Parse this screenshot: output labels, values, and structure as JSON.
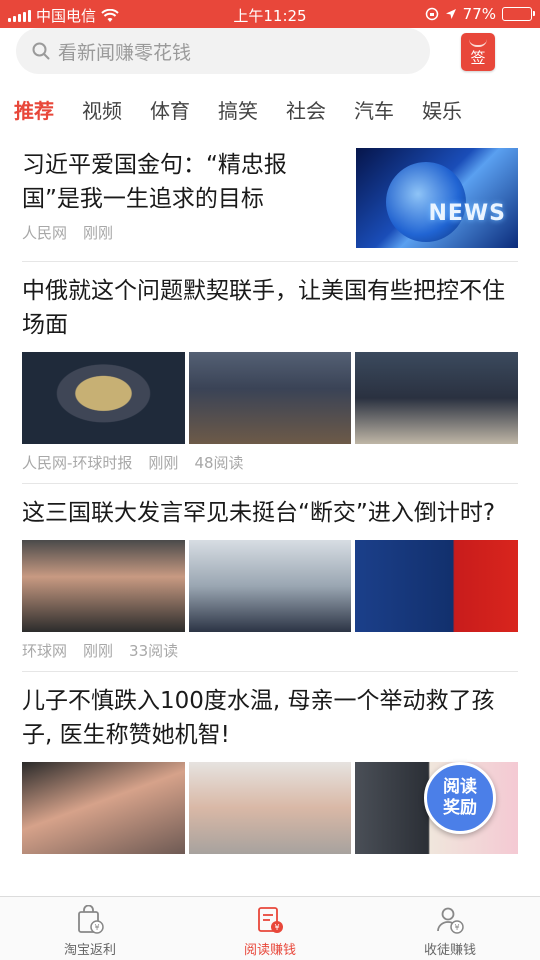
{
  "status_bar": {
    "carrier": "中国电信",
    "time": "上午11:25",
    "battery": "77%",
    "battery_level": 0.77
  },
  "search": {
    "placeholder": "看新闻赚零花钱",
    "sign_label": "签"
  },
  "tabs": [
    {
      "label": "推荐",
      "active": true
    },
    {
      "label": "视频"
    },
    {
      "label": "体育"
    },
    {
      "label": "搞笑"
    },
    {
      "label": "社会"
    },
    {
      "label": "汽车"
    },
    {
      "label": "娱乐"
    }
  ],
  "articles": [
    {
      "title": "习近平爱国金句：“精忠报国”是我一生追求的目标",
      "source": "人民网",
      "time": "刚刚",
      "thumb_text": "NEWS"
    },
    {
      "title": "中俄就这个问题默契联手，让美国有些把控不住场面",
      "source": "人民网-环球时报",
      "time": "刚刚",
      "reads": "48阅读"
    },
    {
      "title": "这三国联大发言罕见未挺台“断交”进入倒计时?",
      "source": "环球网",
      "time": "刚刚",
      "reads": "33阅读"
    },
    {
      "title": "儿子不慎跌入100度水温, 母亲一个举动救了孩子, 医生称赞她机智!"
    }
  ],
  "reward_badge": {
    "line1": "阅读",
    "line2": "奖励"
  },
  "bottom_nav": [
    {
      "label": "淘宝返利"
    },
    {
      "label": "阅读赚钱",
      "active": true
    },
    {
      "label": "收徒赚钱"
    }
  ],
  "colors": {
    "accent": "#e8473a",
    "badge": "#4b7fe8"
  }
}
